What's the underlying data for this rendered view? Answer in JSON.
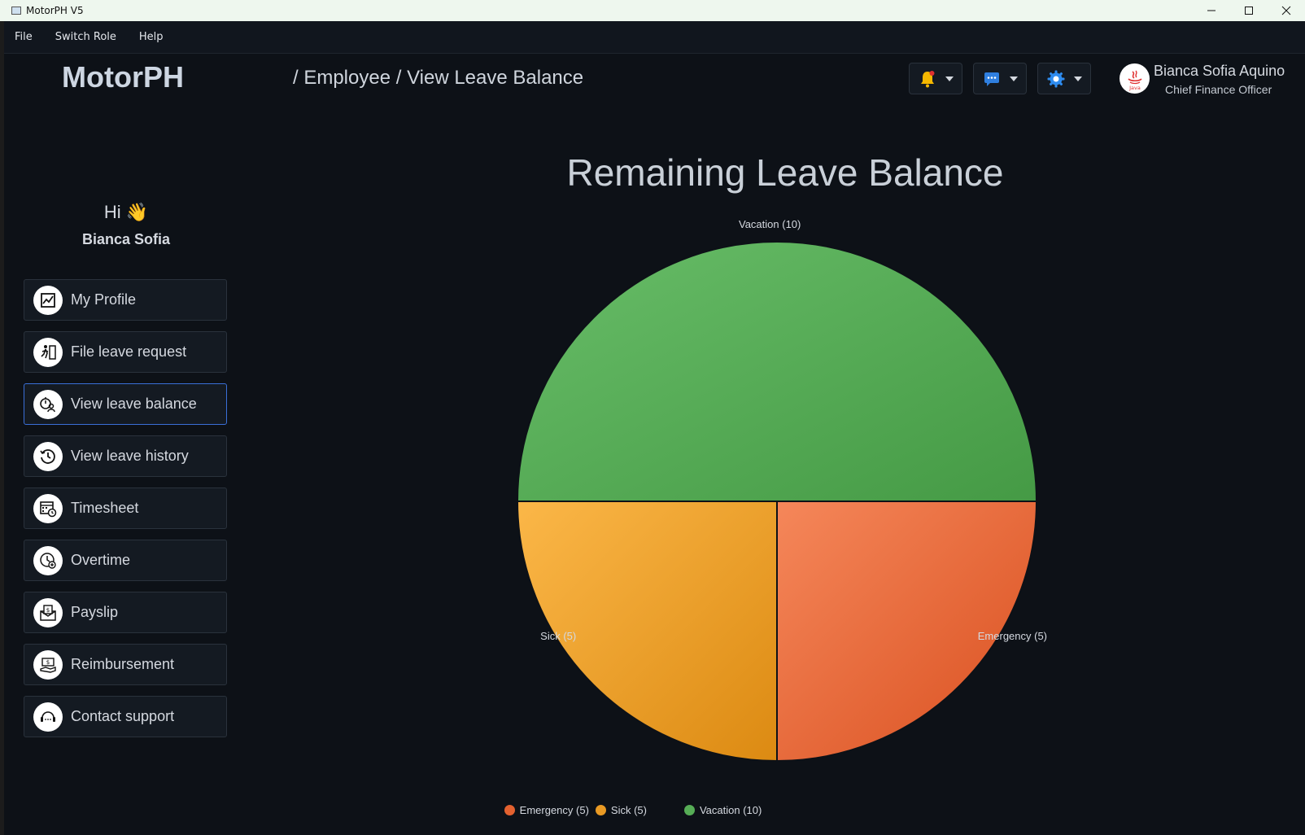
{
  "window": {
    "title": "MotorPH V5"
  },
  "menubar": {
    "items": [
      "File",
      "Switch Role",
      "Help"
    ]
  },
  "header": {
    "logo": "MotorPH",
    "breadcrumb": "/ Employee / View Leave Balance",
    "user_name": "Bianca Sofia Aquino",
    "user_role": "Chief Finance Officer",
    "avatar_text": "Java"
  },
  "greeting": {
    "hi": "Hi 👋",
    "name": "Bianca Sofia"
  },
  "sidebar": {
    "items": [
      {
        "label": "My Profile",
        "icon": "profile-chart-icon"
      },
      {
        "label": "File leave request",
        "icon": "leave-request-icon"
      },
      {
        "label": "View leave balance",
        "icon": "leave-balance-icon",
        "active": true
      },
      {
        "label": "View leave history",
        "icon": "history-icon"
      },
      {
        "label": "Timesheet",
        "icon": "calendar-clock-icon"
      },
      {
        "label": "Overtime",
        "icon": "overtime-clock-icon"
      },
      {
        "label": "Payslip",
        "icon": "payslip-envelope-icon"
      },
      {
        "label": "Reimbursement",
        "icon": "reimbursement-icon"
      },
      {
        "label": "Contact support",
        "icon": "headset-icon"
      }
    ]
  },
  "colors": {
    "background": "#0d1117",
    "active_border": "#3a6fd8",
    "vacation": "#56ad56",
    "sick": "#e99a24",
    "emergency": "#e3612f"
  },
  "chart_data": {
    "type": "pie",
    "title": "Remaining Leave Balance",
    "slices": [
      {
        "label": "Emergency (5)",
        "value": 5,
        "color": "#e3612f"
      },
      {
        "label": "Sick (5)",
        "value": 5,
        "color": "#e99a24"
      },
      {
        "label": "Vacation (10)",
        "value": 10,
        "color": "#56ad56"
      }
    ],
    "legend": [
      "Emergency (5)",
      "Sick (5)",
      "Vacation (10)"
    ],
    "legend_position": "bottom"
  }
}
